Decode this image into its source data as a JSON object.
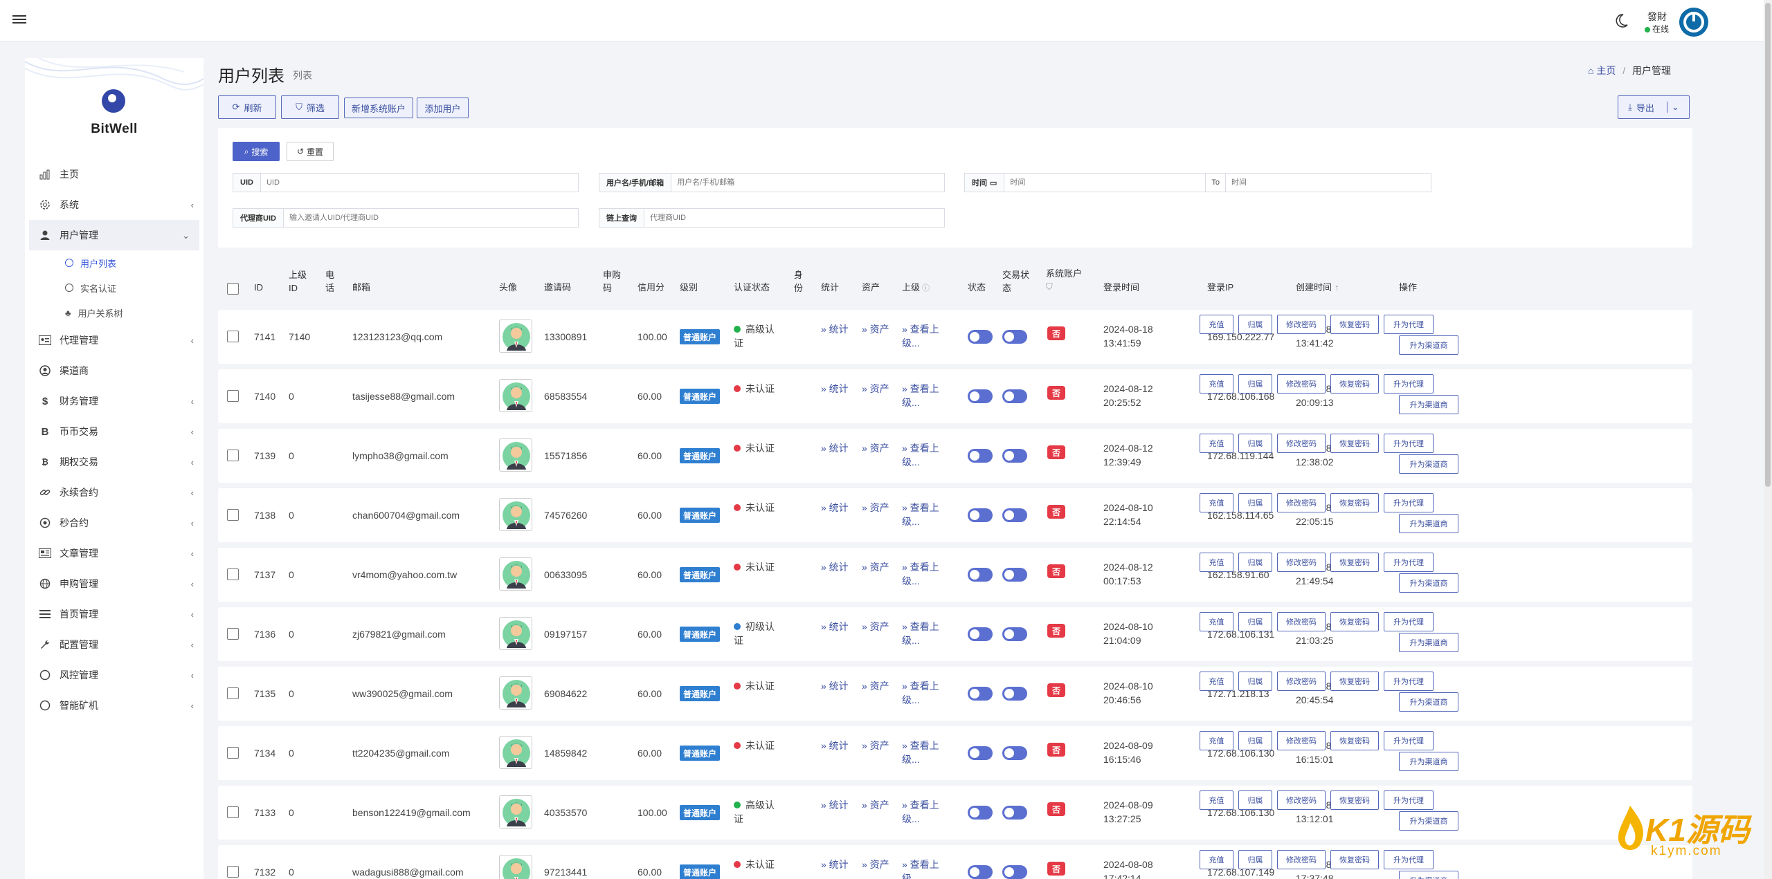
{
  "topbar": {
    "user_name": "發財",
    "user_status": "在线"
  },
  "sidebar": {
    "brand": "BitWell",
    "items": [
      {
        "label": "主页",
        "icon": "chart-bar-icon",
        "has_sub": false
      },
      {
        "label": "系统",
        "icon": "gear-icon",
        "has_sub": true
      },
      {
        "label": "用户管理",
        "icon": "user-icon",
        "has_sub": true,
        "expanded": true
      },
      {
        "label": "代理管理",
        "icon": "id-card-icon",
        "has_sub": true
      },
      {
        "label": "渠道商",
        "icon": "user-circle-icon",
        "has_sub": false
      },
      {
        "label": "财务管理",
        "icon": "dollar-icon",
        "has_sub": true
      },
      {
        "label": "币币交易",
        "icon": "bitcoin-icon",
        "has_sub": true
      },
      {
        "label": "期权交易",
        "icon": "bitcoin-small-icon",
        "has_sub": true
      },
      {
        "label": "永续合约",
        "icon": "link-icon",
        "has_sub": true
      },
      {
        "label": "秒合约",
        "icon": "dot-circle-icon",
        "has_sub": true
      },
      {
        "label": "文章管理",
        "icon": "newspaper-icon",
        "has_sub": true
      },
      {
        "label": "申购管理",
        "icon": "globe-icon",
        "has_sub": true
      },
      {
        "label": "首页管理",
        "icon": "list-icon",
        "has_sub": true
      },
      {
        "label": "配置管理",
        "icon": "wrench-icon",
        "has_sub": true
      },
      {
        "label": "风控管理",
        "icon": "circle-icon",
        "has_sub": true
      },
      {
        "label": "智能矿机",
        "icon": "circle-icon",
        "has_sub": true
      }
    ],
    "sub_items": [
      {
        "label": "用户列表",
        "active": true
      },
      {
        "label": "实名认证",
        "active": false
      },
      {
        "label": "用户关系树",
        "active": false
      }
    ]
  },
  "page": {
    "title": "用户列表",
    "subtitle": "列表",
    "breadcrumb_home": "主页",
    "breadcrumb_current": "用户管理"
  },
  "toolbar": {
    "refresh": "刷新",
    "filter": "筛选",
    "add_system": "新增系统账户",
    "add_user": "添加用户",
    "export": "导出"
  },
  "search": {
    "search_btn": "搜索",
    "reset_btn": "重置",
    "uid_label": "UID",
    "uid_placeholder": "UID",
    "user_label": "用户名/手机/邮箱",
    "user_placeholder": "用户名/手机/邮箱",
    "time_label": "时间",
    "time_from_placeholder": "时间",
    "time_to_label": "To",
    "time_to_placeholder": "时间",
    "agent_label": "代理商UID",
    "agent_placeholder": "输入邀请人UID/代理商UID",
    "chain_label": "链上查询",
    "chain_placeholder": "代理商UID"
  },
  "table": {
    "headers": {
      "id": "ID",
      "parent_id": "上级ID",
      "phone": "电话",
      "email": "邮箱",
      "avatar": "头像",
      "invite": "邀请码",
      "apply": "申购码",
      "credit": "信用分",
      "level": "级别",
      "auth": "认证状态",
      "identity": "身份",
      "stats": "统计",
      "assets": "资产",
      "parent": "上级",
      "status": "状态",
      "trade_status": "交易状态",
      "system_account": "系统账户",
      "login_time": "登录时间",
      "login_ip": "登录IP",
      "created": "创建时间",
      "actions": "操作"
    },
    "level_badge": "普通账户",
    "stats_link": "» 统计",
    "assets_link": "» 资产",
    "parent_link": "» 查看上级...",
    "no_label": "否",
    "action_labels": [
      "充值",
      "归属",
      "修改密码",
      "恢复密码",
      "升为代理",
      "升为渠道商"
    ],
    "rows": [
      {
        "id": "7141",
        "parent_id": "7140",
        "email": "123123123@qq.com",
        "invite": "13300891",
        "credit": "100.00",
        "auth": "高级认证",
        "auth_color": "#22b14c",
        "login_date": "2024-08-18",
        "login_clock": "13:41:59",
        "ip": "169.150.222.77",
        "created_date": "2024-08-18",
        "created_clock": "13:41:42"
      },
      {
        "id": "7140",
        "parent_id": "0",
        "email": "tasijesse88@gmail.com",
        "invite": "68583554",
        "credit": "60.00",
        "auth": "未认证",
        "auth_color": "#e53946",
        "login_date": "2024-08-12",
        "login_clock": "20:25:52",
        "ip": "172.68.106.168",
        "created_date": "2024-08-12",
        "created_clock": "20:09:13"
      },
      {
        "id": "7139",
        "parent_id": "0",
        "email": "lympho38@gmail.com",
        "invite": "15571856",
        "credit": "60.00",
        "auth": "未认证",
        "auth_color": "#e53946",
        "login_date": "2024-08-12",
        "login_clock": "12:39:49",
        "ip": "172.68.119.144",
        "created_date": "2024-08-12",
        "created_clock": "12:38:02"
      },
      {
        "id": "7138",
        "parent_id": "0",
        "email": "chan600704@gmail.com",
        "invite": "74576260",
        "credit": "60.00",
        "auth": "未认证",
        "auth_color": "#e53946",
        "login_date": "2024-08-10",
        "login_clock": "22:14:54",
        "ip": "162.158.114.65",
        "created_date": "2024-08-10",
        "created_clock": "22:05:15"
      },
      {
        "id": "7137",
        "parent_id": "0",
        "email": "vr4mom@yahoo.com.tw",
        "invite": "00633095",
        "credit": "60.00",
        "auth": "未认证",
        "auth_color": "#e53946",
        "login_date": "2024-08-12",
        "login_clock": "00:17:53",
        "ip": "162.158.91.60",
        "created_date": "2024-08-10",
        "created_clock": "21:49:54"
      },
      {
        "id": "7136",
        "parent_id": "0",
        "email": "zj679821@gmail.com",
        "invite": "09197157",
        "credit": "60.00",
        "auth": "初级认证",
        "auth_color": "#2f7fd1",
        "login_date": "2024-08-10",
        "login_clock": "21:04:09",
        "ip": "172.68.106.131",
        "created_date": "2024-08-10",
        "created_clock": "21:03:25"
      },
      {
        "id": "7135",
        "parent_id": "0",
        "email": "ww390025@gmail.com",
        "invite": "69084622",
        "credit": "60.00",
        "auth": "未认证",
        "auth_color": "#e53946",
        "login_date": "2024-08-10",
        "login_clock": "20:46:56",
        "ip": "172.71.218.13",
        "created_date": "2024-08-10",
        "created_clock": "20:45:54"
      },
      {
        "id": "7134",
        "parent_id": "0",
        "email": "tt2204235@gmail.com",
        "invite": "14859842",
        "credit": "60.00",
        "auth": "未认证",
        "auth_color": "#e53946",
        "login_date": "2024-08-09",
        "login_clock": "16:15:46",
        "ip": "172.68.106.130",
        "created_date": "2024-08-09",
        "created_clock": "16:15:01"
      },
      {
        "id": "7133",
        "parent_id": "0",
        "email": "benson122419@gmail.com",
        "invite": "40353570",
        "credit": "100.00",
        "auth": "高级认证",
        "auth_color": "#22b14c",
        "login_date": "2024-08-09",
        "login_clock": "13:27:25",
        "ip": "172.68.106.130",
        "created_date": "2024-08-09",
        "created_clock": "13:12:01"
      },
      {
        "id": "7132",
        "parent_id": "0",
        "email": "wadagusi888@gmail.com",
        "invite": "97213441",
        "credit": "60.00",
        "auth": "未认证",
        "auth_color": "#e53946",
        "login_date": "2024-08-08",
        "login_clock": "17:42:14",
        "ip": "172.68.107.149",
        "created_date": "2024-08-08",
        "created_clock": "17:37:48"
      }
    ]
  },
  "watermark": {
    "brand": "K1源码",
    "domain": "k1ym.com"
  }
}
